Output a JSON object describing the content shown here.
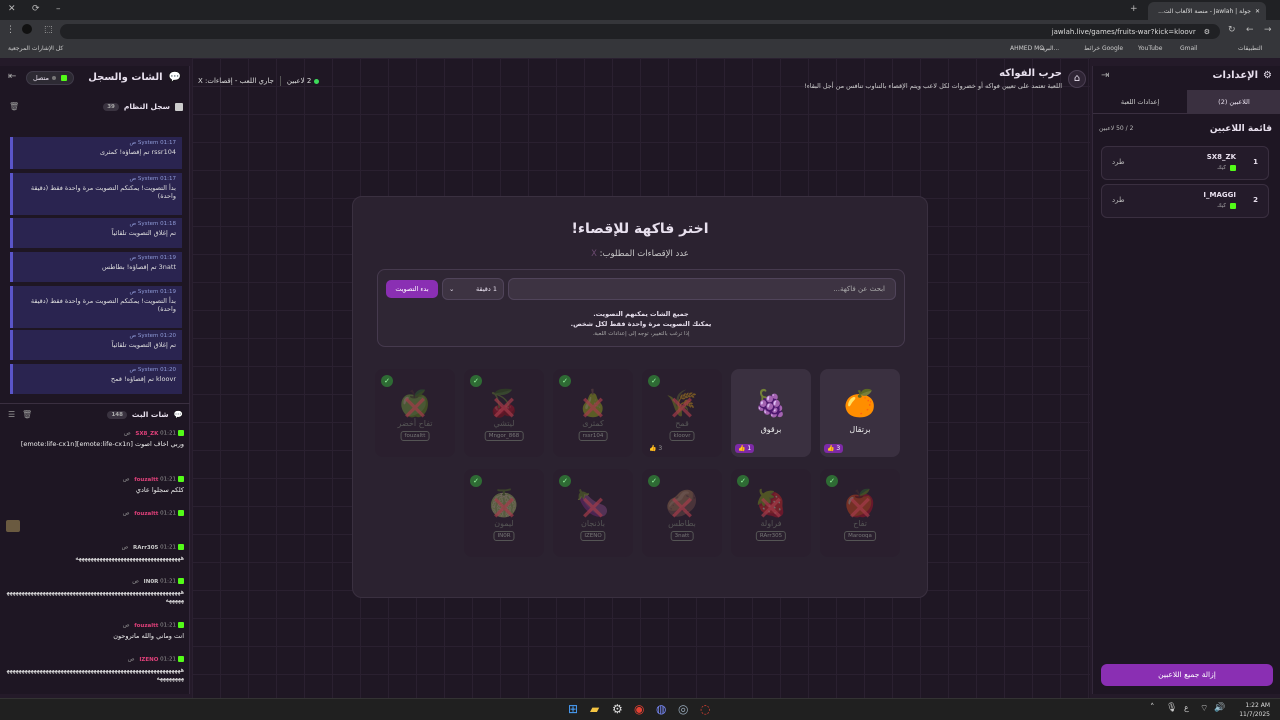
{
  "browser": {
    "tab_title": "جولة | Jawlah - منصة الألعاب الت...",
    "url": "jawlah.live/games/fruits-war?kick=kloovr",
    "bookmarks": [
      "التطبيقات",
      "Gmail",
      "YouTube",
      "خرائط Google",
      "البريد...",
      "AHMED MO...",
      "كل الإشارات المرجعية"
    ]
  },
  "header": {
    "title": "حرب الفواكه",
    "subtitle": "اللعبة تعتمد على تعيين فواكه أو خضروات لكل لاعب ويتم الإقصاء بالتناوب تنافس من أجل البقاء!",
    "players_online": "2 لاعبين",
    "status": "جاري اللعب - إقصاءات: X"
  },
  "left_panel": {
    "title": "الشات والسجل",
    "connection": "متصل",
    "system_log": {
      "title": "سجل النظام",
      "count": "39",
      "messages": [
        {
          "sender": "System",
          "time": "01:17 ص",
          "text": "rssr104 تم إقصاؤه! كمثرى"
        },
        {
          "sender": "System",
          "time": "01:17 ص",
          "text": "بدأ التصويت! يمكنكم التصويت مرة واحدة فقط (دقيقة واحدة)"
        },
        {
          "sender": "System",
          "time": "01:18 ص",
          "text": "تم إغلاق التصويت تلقائياً"
        },
        {
          "sender": "System",
          "time": "01:19 ص",
          "text": "3natt تم إقصاؤه! بطاطس"
        },
        {
          "sender": "System",
          "time": "01:19 ص",
          "text": "بدأ التصويت! يمكنكم التصويت مرة واحدة فقط (دقيقة واحدة)"
        },
        {
          "sender": "System",
          "time": "01:20 ص",
          "text": "تم إغلاق التصويت تلقائياً"
        },
        {
          "sender": "System",
          "time": "01:20 ص",
          "text": "kloovr تم إقصاؤه! قمح"
        }
      ]
    },
    "live_chat": {
      "title": "شات البث",
      "count": "148",
      "messages": [
        {
          "user": "SX8_ZK",
          "color": "#e0407a",
          "time": "01:21 ص",
          "text": "وربي اخاف اصوت [emote:life-cx1n][emote:life-cx1n]"
        },
        {
          "user": "fouzaltt",
          "color": "#e0407a",
          "time": "01:21 ص",
          "text": "كلكم سجلوا عادي"
        },
        {
          "user": "fouzaltt",
          "color": "#e0407a",
          "time": "01:21 ص",
          "text": ""
        },
        {
          "user": "RArr305",
          "color": "#cccccc",
          "time": "01:21 ص",
          "text": "هههههههههههههههههههههههههههههههههههه"
        },
        {
          "user": "IN0R",
          "color": "#cccccc",
          "time": "01:21 ص",
          "text": "ههههههههههههههههههههههههههههههههههههههههههههههههههههههههههههههههه"
        },
        {
          "user": "fouzaltt",
          "color": "#e0407a",
          "time": "01:21 ص",
          "text": "انت وماني والله ماتروحون"
        },
        {
          "user": "IZENO",
          "color": "#e0407a",
          "time": "01:21 ص",
          "text": "هههههههههههههههههههههههههههههههههههههههههههههههههههههههههههههههههههه"
        }
      ]
    }
  },
  "vote_panel": {
    "title": "اختر فاكهة للإقصاء!",
    "required_label": "عدد الإقصاءات المطلوب:",
    "required_value": "X",
    "search_placeholder": "ابحث عن فاكهة...",
    "duration": "1 دقيقة",
    "start_vote": "بدء التصويت",
    "info_line1": "جميع الشات يمكنهم التصويت.",
    "info_line2": "يمكنك التصويت مرة واحدة فقط لكل شخص.",
    "info_line3": "إذا ترغب بالتغيير، توجه إلى إعدادات اللعبة."
  },
  "fruits_row1": [
    {
      "name": "برتقال",
      "emoji": "🍊",
      "state": "active",
      "votes": "3"
    },
    {
      "name": "برقوق",
      "emoji": "🍇",
      "state": "active",
      "votes": "1"
    },
    {
      "name": "قمح",
      "emoji": "🌾",
      "state": "elim",
      "owner": "kloovr",
      "votes": "3"
    },
    {
      "name": "كمثرى",
      "emoji": "🍐",
      "state": "elim",
      "owner": "rssr104"
    },
    {
      "name": "ليتشي",
      "emoji": "🍒",
      "state": "elim",
      "owner": "Mngor_868"
    },
    {
      "name": "تفاح أخضر",
      "emoji": "🍏",
      "state": "elim",
      "owner": "fouzaltt"
    }
  ],
  "fruits_row2": [
    {
      "name": "تفاح",
      "emoji": "🍎",
      "state": "elim",
      "owner": "Marooqa"
    },
    {
      "name": "فراولة",
      "emoji": "🍓",
      "state": "elim",
      "owner": "RArr305"
    },
    {
      "name": "بطاطس",
      "emoji": "🥔",
      "state": "elim",
      "owner": "3natt"
    },
    {
      "name": "باذنجان",
      "emoji": "🍆",
      "state": "elim",
      "owner": "IZENO"
    },
    {
      "name": "ليمون",
      "emoji": "🍈",
      "state": "elim",
      "owner": "IN0R"
    }
  ],
  "right_panel": {
    "title": "الإعدادات",
    "tab_players": "اللاعبين (2)",
    "tab_settings": "إعدادات اللعبة",
    "list_title": "قائمة اللاعبين",
    "list_count": "2 / 50 لاعبين",
    "players": [
      {
        "rank": "1",
        "name": "SX8_ZK",
        "platform": "كيك",
        "kick": "طرد"
      },
      {
        "rank": "2",
        "name": "I_MAGGI",
        "platform": "كيك",
        "kick": "طرد"
      }
    ],
    "remove_all": "إزالة جميع اللاعبين"
  },
  "taskbar": {
    "time": "1:22 AM",
    "date": "11/7/2025",
    "lang": "ع"
  },
  "colors": {
    "accent": "#8a2fb3",
    "kick_green": "#53fc18",
    "system_blue": "#5a55c9"
  }
}
